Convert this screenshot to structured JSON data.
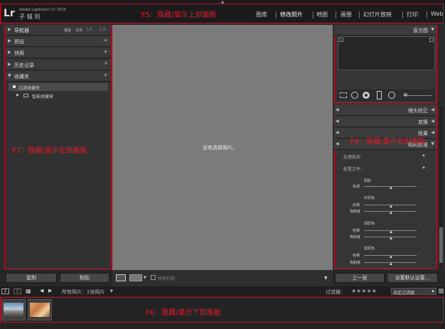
{
  "identity": {
    "logo": "Lr",
    "product": "Adobe Lightroom CC 2015",
    "user": "子 城 刘"
  },
  "modules": [
    "图库",
    "修改照片",
    "地图",
    "画册",
    "幻灯片放映",
    "打印",
    "Web"
  ],
  "annotations": {
    "top": "F5：隐藏/显示上部面板",
    "left": "F7：隐藏/显示左部面板",
    "right": "F8：隐藏/显示右部面板",
    "bottom": "F6：隐藏/显示下部面板"
  },
  "left_panel": {
    "navigator": {
      "label": "导航器",
      "options": [
        "适合",
        "填满",
        "1:1",
        "1:3"
      ]
    },
    "presets": "预设",
    "snapshots": "快照",
    "history": "历史记录",
    "collections": "收藏夹",
    "collection_items": [
      "过滤收藏夹",
      "智能收藏夹"
    ],
    "copy_button": "复制",
    "paste_button": "粘贴"
  },
  "center": {
    "empty_message": "没有选择照片。",
    "soft_proof_label": "校样打样"
  },
  "right_panel": {
    "histogram": "直方图",
    "sections": [
      "镜头校正",
      "变换",
      "效果",
      "相机校准"
    ],
    "process_label": "处理版本：",
    "profile_label": "配置文件：",
    "groups": [
      {
        "title": "阴影",
        "labels": [
          "色调"
        ]
      },
      {
        "title": "红原色",
        "labels": [
          "色相",
          "饱和度"
        ]
      },
      {
        "title": "绿原色",
        "labels": [
          "色相",
          "饱和度"
        ]
      },
      {
        "title": "蓝原色",
        "labels": [
          "色相",
          "饱和度"
        ]
      }
    ],
    "prev_button": "上一张",
    "reset_button": "设置默认设置..."
  },
  "filmstrip": {
    "view1": "1",
    "view2": "2",
    "source": "所有照片：2张照片",
    "filter_label": "过滤器：",
    "stars": "★★★★★",
    "filter_value": "自定过滤器"
  }
}
